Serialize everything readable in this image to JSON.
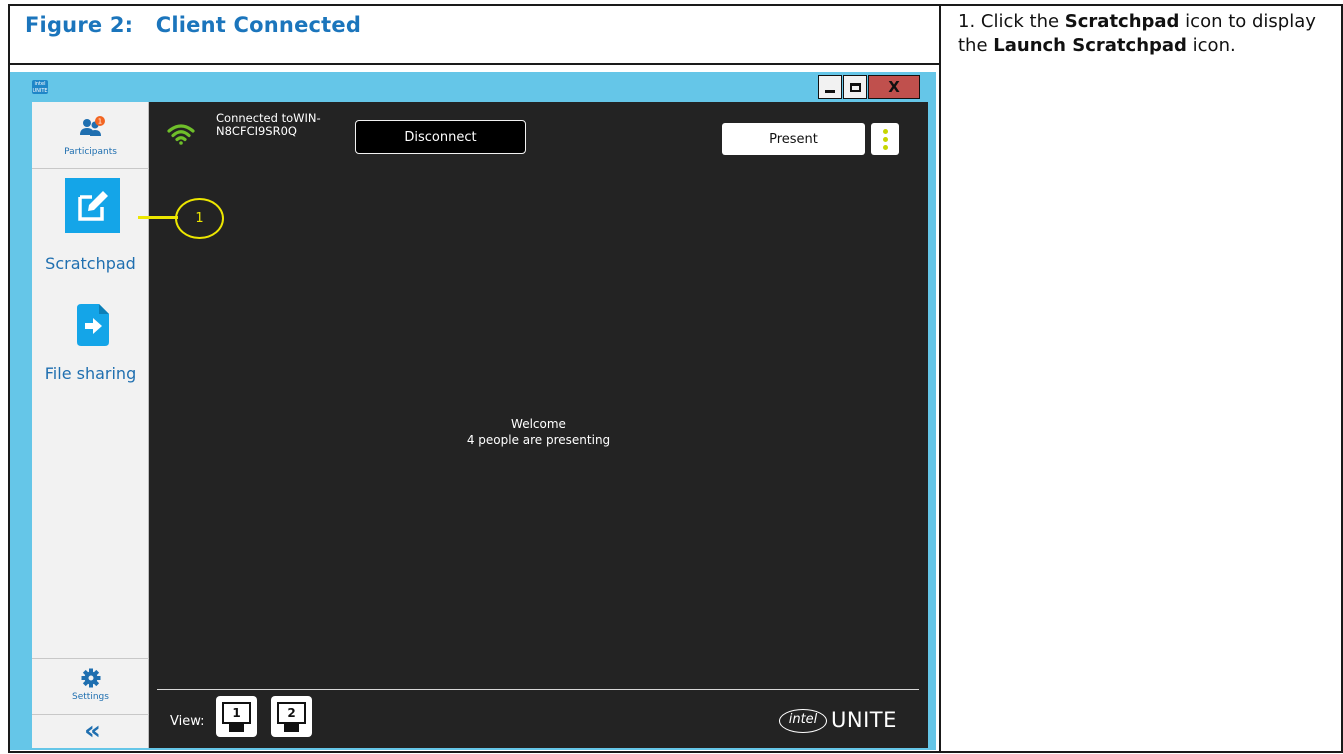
{
  "figure": {
    "title": "Figure 2:   Client Connected"
  },
  "instruction": {
    "prefix": "1. Click the ",
    "target_1": "Scratchpad",
    "middle": " icon to display the ",
    "target_2": "Launch Scratchpad",
    "suffix": " icon."
  },
  "window": {
    "logo_text": "intel UNITE",
    "controls": {
      "close": "X"
    }
  },
  "sidebar": {
    "participants_label": "Participants",
    "participants_badge": "1",
    "items": [
      {
        "label": "Scratchpad",
        "icon": "pencil-edit-icon"
      },
      {
        "label": "File sharing",
        "icon": "file-share-icon"
      }
    ],
    "settings_label": "Settings",
    "collapse_glyph": "«"
  },
  "main": {
    "connection_status": "Connected toWIN-N8CFCI9SR0Q",
    "disconnect_label": "Disconnect",
    "present_label": "Present",
    "welcome_title": "Welcome",
    "welcome_subtitle": "4  people are presenting",
    "view_label": "View:",
    "view_options": [
      "1",
      "2"
    ],
    "brand_intel": "intel",
    "brand_unite": "UNITE"
  },
  "callout": {
    "number": "1"
  },
  "colors": {
    "title_blue": "#1b75bc",
    "window_chrome": "#65c6e8",
    "accent_blue": "#14a5e8",
    "wifi_green": "#6fbf2a",
    "callout_yellow": "#ece600",
    "badge_orange": "#f26522",
    "close_red": "#c0504d"
  }
}
